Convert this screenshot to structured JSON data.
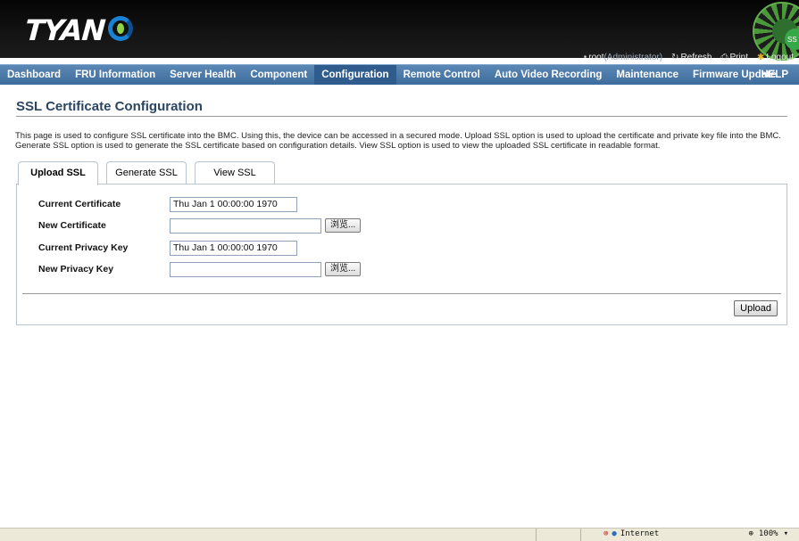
{
  "brand": {
    "logo_text": "TYAN",
    "corner_badge": "SS"
  },
  "userbar": {
    "user": "root",
    "role": "(Administrator)",
    "refresh_label": "Refresh",
    "print_label": "Print",
    "logout_label": "Logout"
  },
  "nav": {
    "items": [
      "Dashboard",
      "FRU Information",
      "Server Health",
      "Component",
      "Configuration",
      "Remote Control",
      "Auto Video Recording",
      "Maintenance",
      "Firmware Update"
    ],
    "active": "Configuration",
    "help_label": "HELP"
  },
  "page": {
    "title": "SSL Certificate Configuration",
    "description": "This page is used to configure SSL certificate into the BMC. Using this, the device can be accessed in a secured mode. Upload SSL option is used to upload the certificate and private key file into the BMC. Generate SSL option is used to generate the SSL certificate based on configuration details. View SSL option is used to view the uploaded SSL certificate in readable format."
  },
  "tabs": [
    "Upload SSL",
    "Generate SSL",
    "View SSL"
  ],
  "form": {
    "current_certificate_label": "Current Certificate",
    "current_certificate_value": "Thu Jan  1 00:00:00 1970",
    "new_certificate_label": "New Certificate",
    "new_certificate_value": "",
    "current_privacy_key_label": "Current Privacy Key",
    "current_privacy_key_value": "Thu Jan  1 00:00:00 1970",
    "new_privacy_key_label": "New Privacy Key",
    "new_privacy_key_value": "",
    "browse_label": "浏览...",
    "upload_label": "Upload"
  },
  "statusbar": {
    "zone": "Internet",
    "zoom": "100%"
  },
  "colors": {
    "nav_bg": "#4a78a8",
    "nav_active": "#2f5c8c",
    "title": "#2b4563",
    "header_bg": "#0d0d0d"
  }
}
